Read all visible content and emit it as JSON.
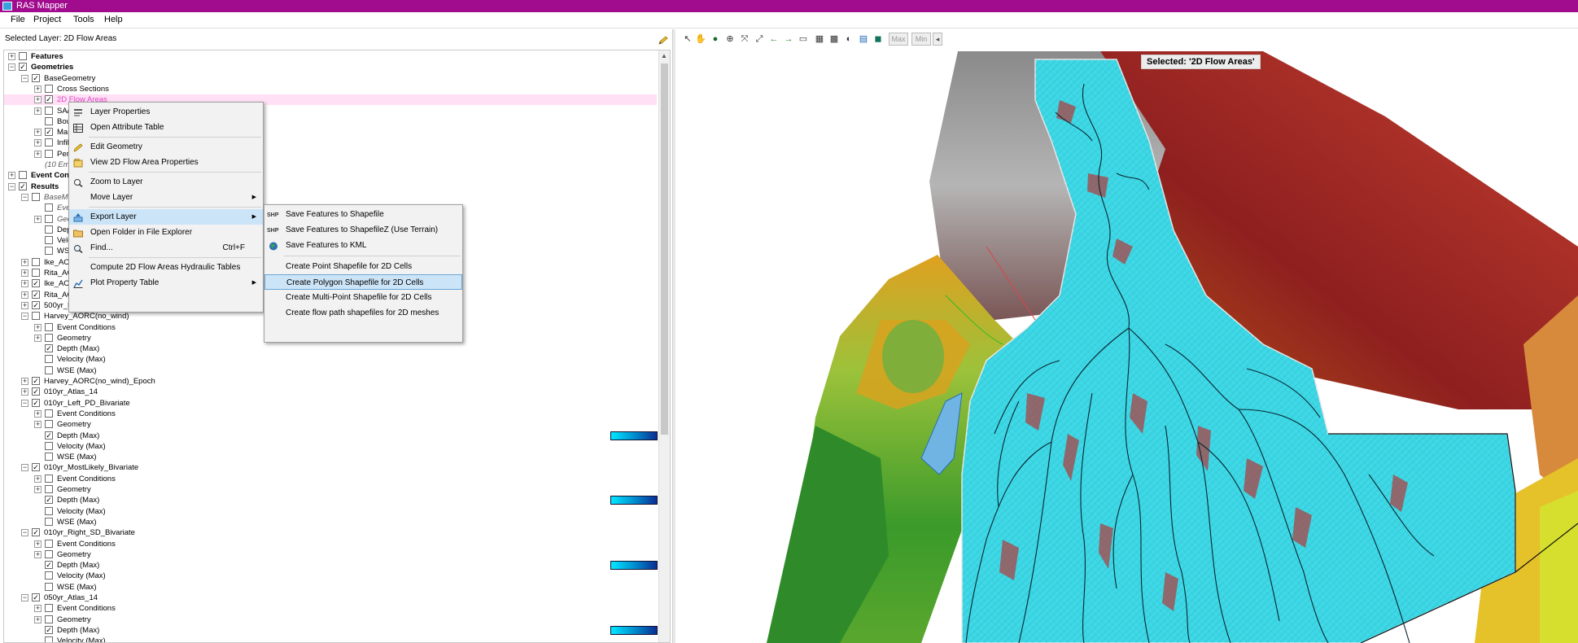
{
  "window": {
    "title": "RAS Mapper"
  },
  "menubar": [
    "File",
    "Project",
    "Tools",
    "Help"
  ],
  "panel": {
    "selected_layer_text": "Selected Layer: 2D Flow Areas"
  },
  "tree": [
    {
      "label": "Features",
      "indent": 0,
      "expand": "+",
      "checked": false,
      "bold": true
    },
    {
      "label": "Geometries",
      "indent": 0,
      "expand": "−",
      "checked": true,
      "bold": true
    },
    {
      "label": "BaseGeometry",
      "indent": 1,
      "expand": "−",
      "checked": true
    },
    {
      "label": "Cross Sections",
      "indent": 2,
      "expand": "+",
      "checked": false
    },
    {
      "label": "2D Flow Areas",
      "indent": 2,
      "expand": "+",
      "checked": true,
      "highlight": true
    },
    {
      "label": "SA/2D Area Conn",
      "indent": 2,
      "expand": "+",
      "checked": false
    },
    {
      "label": "Boundary Condition Lines",
      "indent": 2,
      "expand": "",
      "checked": false
    },
    {
      "label": "Manning's n",
      "indent": 2,
      "expand": "+",
      "checked": true
    },
    {
      "label": "Infiltration",
      "indent": 2,
      "expand": "+",
      "checked": false
    },
    {
      "label": "Percent Impervious",
      "indent": 2,
      "expand": "+",
      "checked": false
    },
    {
      "label": "(10 Empty Layers)",
      "indent": 2,
      "expand": "",
      "checked": null,
      "italic": true
    },
    {
      "label": "Event Conditions",
      "indent": 0,
      "expand": "+",
      "checked": false,
      "bold": true
    },
    {
      "label": "Results",
      "indent": 0,
      "expand": "−",
      "checked": true,
      "bold": true
    },
    {
      "label": "BaseModel",
      "indent": 1,
      "expand": "−",
      "checked": false,
      "italic": true
    },
    {
      "label": "Event Conditions",
      "indent": 2,
      "expand": "",
      "checked": false,
      "italic": true
    },
    {
      "label": "Geometry",
      "indent": 2,
      "expand": "+",
      "checked": false,
      "italic": true
    },
    {
      "label": "Depth",
      "indent": 2,
      "expand": "",
      "checked": false
    },
    {
      "label": "Velocity",
      "indent": 2,
      "expand": "",
      "checked": false
    },
    {
      "label": "WSE",
      "indent": 2,
      "expand": "",
      "checked": false
    },
    {
      "label": "Ike_AORC",
      "indent": 1,
      "expand": "+",
      "checked": false
    },
    {
      "label": "Rita_AORC",
      "indent": 1,
      "expand": "+",
      "checked": false
    },
    {
      "label": "Ike_AORC(no_wind)_Epoch",
      "indent": 1,
      "expand": "+",
      "checked": true
    },
    {
      "label": "Rita_AORC(no_wind)_Epoch",
      "indent": 1,
      "expand": "+",
      "checked": true
    },
    {
      "label": "500yr_Right_SD_Bivariate",
      "indent": 1,
      "expand": "+",
      "checked": true
    },
    {
      "label": "Harvey_AORC(no_wind)",
      "indent": 1,
      "expand": "−",
      "checked": false
    },
    {
      "label": "Event Conditions",
      "indent": 2,
      "expand": "+",
      "checked": false
    },
    {
      "label": "Geometry",
      "indent": 2,
      "expand": "+",
      "checked": false
    },
    {
      "label": "Depth (Max)",
      "indent": 2,
      "expand": "",
      "checked": true
    },
    {
      "label": "Velocity (Max)",
      "indent": 2,
      "expand": "",
      "checked": false
    },
    {
      "label": "WSE (Max)",
      "indent": 2,
      "expand": "",
      "checked": false
    },
    {
      "label": "Harvey_AORC(no_wind)_Epoch",
      "indent": 1,
      "expand": "+",
      "checked": true
    },
    {
      "label": "010yr_Atlas_14",
      "indent": 1,
      "expand": "+",
      "checked": true
    },
    {
      "label": "010yr_Left_PD_Bivariate",
      "indent": 1,
      "expand": "−",
      "checked": true
    },
    {
      "label": "Event Conditions",
      "indent": 2,
      "expand": "+",
      "checked": false
    },
    {
      "label": "Geometry",
      "indent": 2,
      "expand": "+",
      "checked": false
    },
    {
      "label": "Depth (Max)",
      "indent": 2,
      "expand": "",
      "checked": true,
      "legend": true
    },
    {
      "label": "Velocity (Max)",
      "indent": 2,
      "expand": "",
      "checked": false
    },
    {
      "label": "WSE (Max)",
      "indent": 2,
      "expand": "",
      "checked": false
    },
    {
      "label": "010yr_MostLikely_Bivariate",
      "indent": 1,
      "expand": "−",
      "checked": true
    },
    {
      "label": "Event Conditions",
      "indent": 2,
      "expand": "+",
      "checked": false
    },
    {
      "label": "Geometry",
      "indent": 2,
      "expand": "+",
      "checked": false
    },
    {
      "label": "Depth (Max)",
      "indent": 2,
      "expand": "",
      "checked": true,
      "legend": true
    },
    {
      "label": "Velocity (Max)",
      "indent": 2,
      "expand": "",
      "checked": false
    },
    {
      "label": "WSE (Max)",
      "indent": 2,
      "expand": "",
      "checked": false
    },
    {
      "label": "010yr_Right_SD_Bivariate",
      "indent": 1,
      "expand": "−",
      "checked": true
    },
    {
      "label": "Event Conditions",
      "indent": 2,
      "expand": "+",
      "checked": false
    },
    {
      "label": "Geometry",
      "indent": 2,
      "expand": "+",
      "checked": false
    },
    {
      "label": "Depth (Max)",
      "indent": 2,
      "expand": "",
      "checked": true,
      "legend": true
    },
    {
      "label": "Velocity (Max)",
      "indent": 2,
      "expand": "",
      "checked": false
    },
    {
      "label": "WSE (Max)",
      "indent": 2,
      "expand": "",
      "checked": false
    },
    {
      "label": "050yr_Atlas_14",
      "indent": 1,
      "expand": "−",
      "checked": true
    },
    {
      "label": "Event Conditions",
      "indent": 2,
      "expand": "+",
      "checked": false
    },
    {
      "label": "Geometry",
      "indent": 2,
      "expand": "+",
      "checked": false
    },
    {
      "label": "Depth (Max)",
      "indent": 2,
      "expand": "",
      "checked": true,
      "legend": true
    },
    {
      "label": "Velocity (Max)",
      "indent": 2,
      "expand": "",
      "checked": false
    }
  ],
  "context_menu": [
    {
      "label": "Layer Properties",
      "icon": "layer-properties-icon"
    },
    {
      "label": "Open Attribute Table",
      "icon": "table-icon"
    },
    {
      "sep": true
    },
    {
      "label": "Edit Geometry",
      "icon": "pencil-icon"
    },
    {
      "label": "View 2D Flow Area Properties",
      "icon": "properties-icon"
    },
    {
      "sep": true
    },
    {
      "label": "Zoom to Layer",
      "icon": "zoom-icon"
    },
    {
      "label": "Move Layer",
      "submenu": true
    },
    {
      "sep": true
    },
    {
      "label": "Export Layer",
      "icon": "export-icon",
      "submenu": true,
      "active": true
    },
    {
      "label": "Open Folder in File Explorer",
      "icon": "folder-icon"
    },
    {
      "label": "Find...",
      "icon": "find-icon",
      "shortcut": "Ctrl+F"
    },
    {
      "sep": true
    },
    {
      "label": "Compute 2D Flow Areas Hydraulic Tables"
    },
    {
      "label": "Plot Property Table",
      "icon": "chart-icon",
      "submenu": true
    }
  ],
  "export_submenu": [
    {
      "label": "Save Features to Shapefile",
      "icon": "SHP"
    },
    {
      "label": "Save Features to ShapefileZ (Use Terrain)",
      "icon": "SHP"
    },
    {
      "label": "Save Features to KML",
      "icon": "globe"
    },
    {
      "sep": true
    },
    {
      "label": "Create Point Shapefile for 2D Cells"
    },
    {
      "label": "Create Polygon Shapefile for 2D Cells",
      "active": true
    },
    {
      "label": "Create Multi-Point Shapefile for 2D Cells"
    },
    {
      "label": "Create flow path shapefiles for 2D meshes"
    }
  ],
  "toolbar": {
    "max_label": "Max",
    "min_label": "Min"
  },
  "map": {
    "selected_label": "Selected: '2D Flow Areas'"
  },
  "colors": {
    "title_bar": "#a10c8f",
    "flow_area": "#3ed8e6",
    "menu_highlight": "#cce4f7"
  }
}
